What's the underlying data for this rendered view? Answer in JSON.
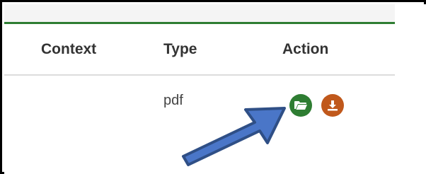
{
  "table": {
    "columns": {
      "context": "Context",
      "type": "Type",
      "action": "Action"
    },
    "rows": [
      {
        "context": "",
        "type": "pdf",
        "actions": [
          {
            "icon": "folder-open-icon",
            "color": "#2e7d32"
          },
          {
            "icon": "download-icon",
            "color": "#c0581b"
          }
        ]
      }
    ]
  },
  "colors": {
    "header_rule": "#2e7d32",
    "open_button": "#2e7d32",
    "download_button": "#c0581b",
    "callout_arrow_fill": "#4a76c8",
    "callout_arrow_stroke": "#2f4f86"
  },
  "callout": {
    "icon": "arrow-pointer-icon",
    "target": "open-file-button"
  }
}
